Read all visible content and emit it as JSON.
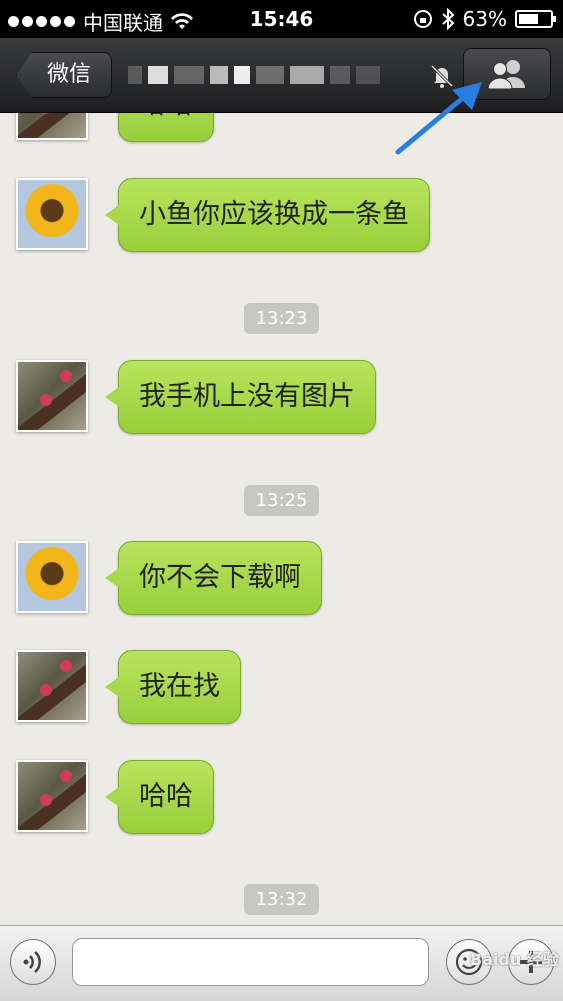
{
  "status_bar": {
    "carrier": "中国联通",
    "time": "15:46",
    "battery": "63%",
    "battery_level": 0.63
  },
  "nav": {
    "back_label": "微信",
    "title": "",
    "icons": [
      "mute-icon",
      "group-members-icon"
    ]
  },
  "messages": [
    {
      "type": "msg",
      "avatar": "branch",
      "text": "哈哈"
    },
    {
      "type": "msg",
      "avatar": "sunflower",
      "text": "小鱼你应该换成一条鱼"
    },
    {
      "type": "time",
      "text": "13:23"
    },
    {
      "type": "msg",
      "avatar": "branch",
      "text": "我手机上没有图片"
    },
    {
      "type": "time",
      "text": "13:25"
    },
    {
      "type": "msg",
      "avatar": "sunflower",
      "text": "你不会下载啊"
    },
    {
      "type": "msg",
      "avatar": "branch",
      "text": "我在找"
    },
    {
      "type": "msg",
      "avatar": "branch",
      "text": "哈哈"
    },
    {
      "type": "time",
      "text": "13:32"
    }
  ],
  "input_bar": {
    "placeholder": "",
    "icons": [
      "voice-icon",
      "emoji-icon",
      "plus-icon"
    ]
  },
  "watermark": "Baidu 经验"
}
